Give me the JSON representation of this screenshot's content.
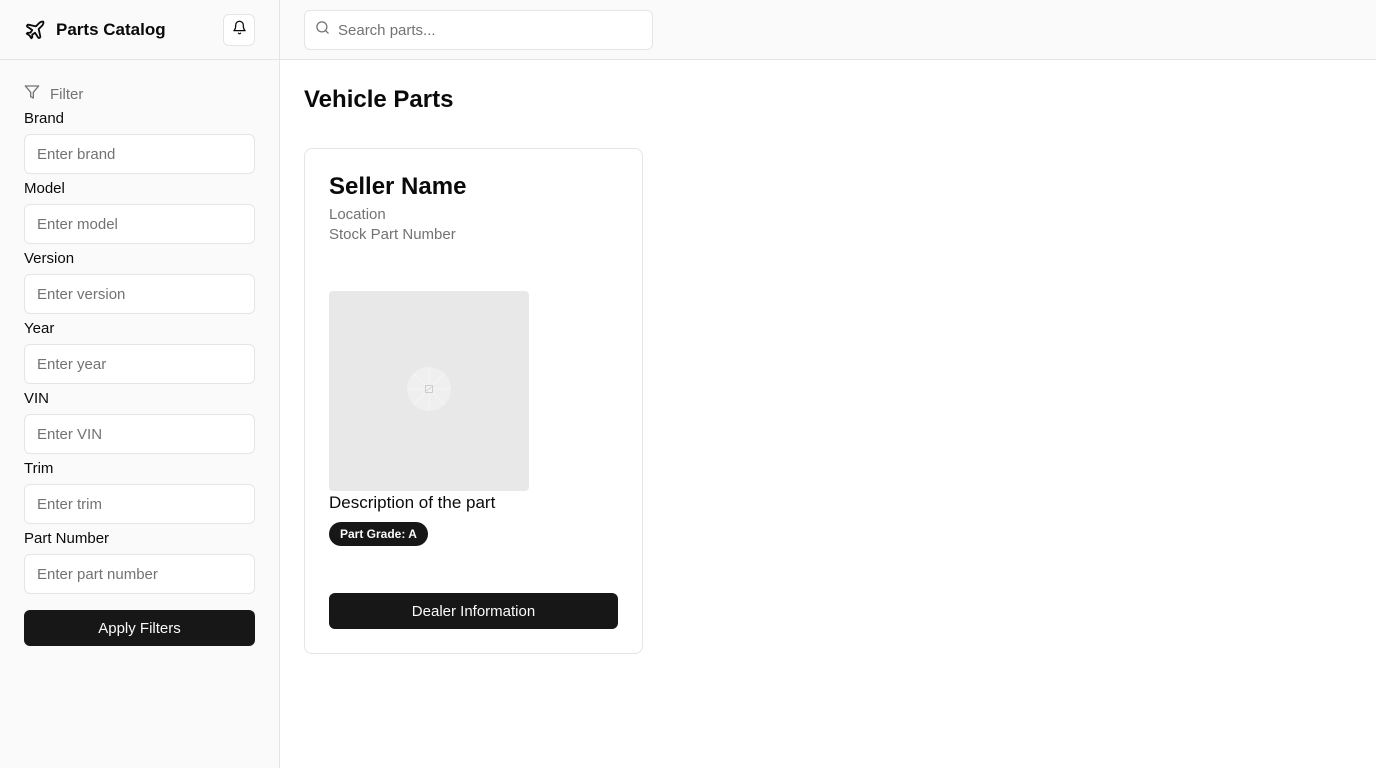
{
  "app": {
    "title": "Parts Catalog",
    "brand_icon": "plane-icon",
    "notifications_icon": "bell-icon"
  },
  "search": {
    "placeholder": "Search parts...",
    "value": "",
    "icon": "search-icon"
  },
  "sidebar": {
    "filter_heading": "Filter",
    "filter_icon": "filter-icon",
    "fields": [
      {
        "label": "Brand",
        "placeholder": "Enter brand",
        "value": ""
      },
      {
        "label": "Model",
        "placeholder": "Enter model",
        "value": ""
      },
      {
        "label": "Version",
        "placeholder": "Enter version",
        "value": ""
      },
      {
        "label": "Year",
        "placeholder": "Enter year",
        "value": ""
      },
      {
        "label": "VIN",
        "placeholder": "Enter VIN",
        "value": ""
      },
      {
        "label": "Trim",
        "placeholder": "Enter trim",
        "value": ""
      },
      {
        "label": "Part Number",
        "placeholder": "Enter part number",
        "value": ""
      }
    ],
    "apply_label": "Apply Filters"
  },
  "main": {
    "title": "Vehicle Parts",
    "cards": [
      {
        "seller_name": "Seller Name",
        "location": "Location",
        "stock_part_number": "Stock Part Number",
        "image_icon": "image-placeholder-icon",
        "description": "Description of the part",
        "grade": "Part Grade: A",
        "button_label": "Dealer Information"
      }
    ]
  },
  "colors": {
    "primary": "#171717",
    "muted_text": "#737373",
    "border": "#e5e5e5",
    "sidebar_bg": "#fafafa",
    "image_bg": "#e8e8e8"
  }
}
